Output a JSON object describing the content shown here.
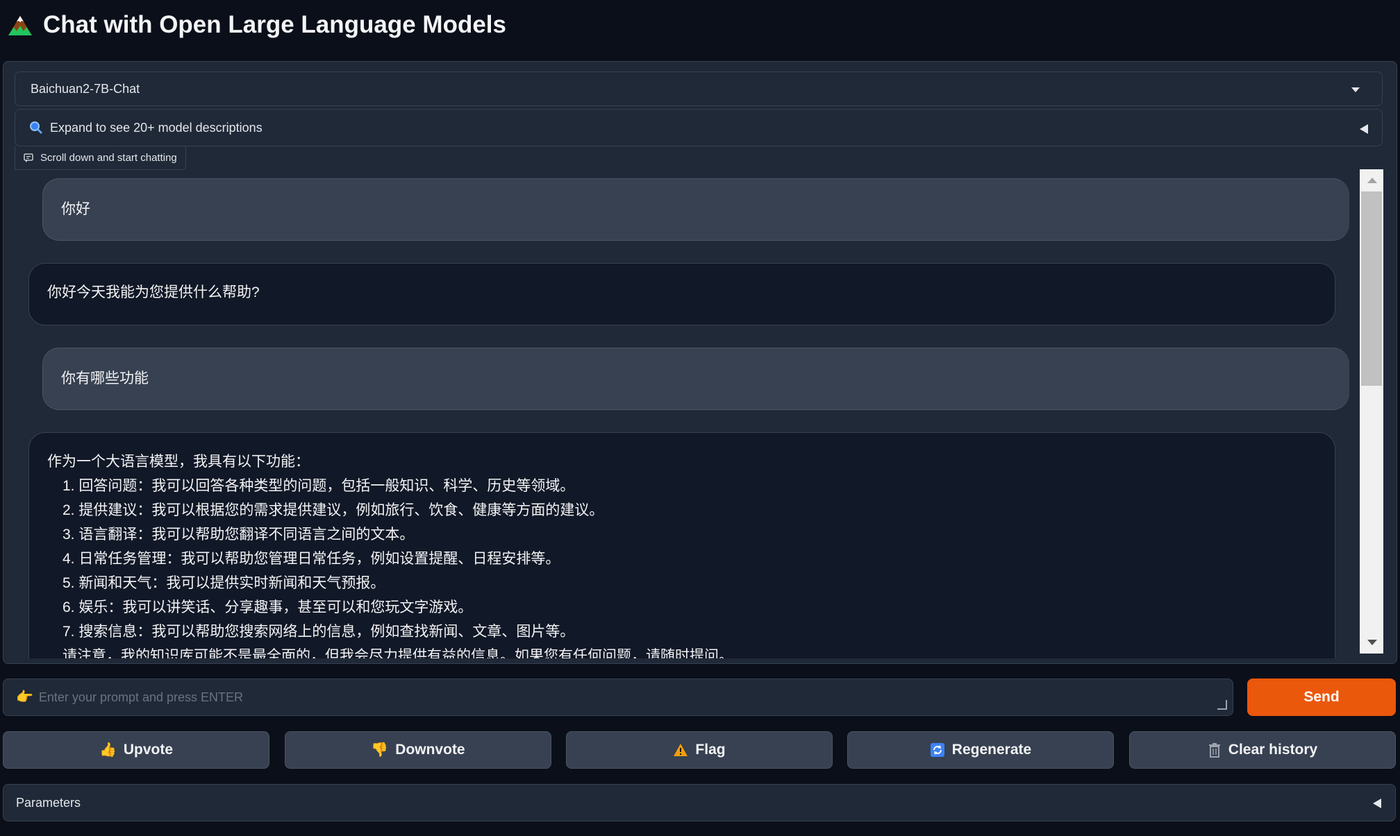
{
  "header": {
    "title": "Chat with Open Large Language Models",
    "logo_icon": "mountain-logo"
  },
  "model_select": {
    "value": "Baichuan2-7B-Chat"
  },
  "model_desc_accordion": {
    "label": "Expand to see 20+ model descriptions",
    "icon": "magnifier-icon"
  },
  "chat": {
    "label": "Scroll down and start chatting",
    "messages": [
      {
        "role": "user",
        "text": "你好"
      },
      {
        "role": "bot",
        "text": "你好今天我能为您提供什么帮助?"
      },
      {
        "role": "user",
        "text": "你有哪些功能"
      },
      {
        "role": "bot",
        "intro": "作为一个大语言模型，我具有以下功能：",
        "items": [
          "1. 回答问题：我可以回答各种类型的问题，包括一般知识、科学、历史等领域。",
          "2. 提供建议：我可以根据您的需求提供建议，例如旅行、饮食、健康等方面的建议。",
          "3. 语言翻译：我可以帮助您翻译不同语言之间的文本。",
          "4. 日常任务管理：我可以帮助您管理日常任务，例如设置提醒、日程安排等。",
          "5. 新闻和天气：我可以提供实时新闻和天气预报。",
          "6. 娱乐：我可以讲笑话、分享趣事，甚至可以和您玩文字游戏。",
          "7. 搜索信息：我可以帮助您搜索网络上的信息，例如查找新闻、文章、图片等。",
          "请注意，我的知识库可能不是最全面的，但我会尽力提供有益的信息。如果您有任何问题，请随时提问。"
        ]
      }
    ]
  },
  "prompt": {
    "placeholder": "Enter your prompt and press ENTER",
    "icon": "pointing-hand-icon"
  },
  "send_button": {
    "label": "Send"
  },
  "actions": [
    {
      "label": "Upvote",
      "icon": "thumbs-up-icon"
    },
    {
      "label": "Downvote",
      "icon": "thumbs-down-icon"
    },
    {
      "label": "Flag",
      "icon": "warning-icon"
    },
    {
      "label": "Regenerate",
      "icon": "refresh-icon"
    },
    {
      "label": "Clear history",
      "icon": "trash-icon"
    }
  ],
  "parameters": {
    "label": "Parameters"
  },
  "colors": {
    "background": "#0b0f19",
    "panel": "#1f2937",
    "accent": "#ea580c"
  }
}
